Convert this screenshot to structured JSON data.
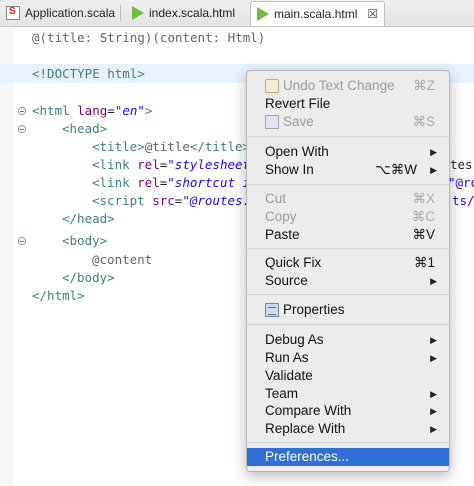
{
  "tabs": [
    {
      "label": "Application.scala",
      "icon": "scala-file-icon",
      "active": false
    },
    {
      "label": "index.scala.html",
      "icon": "play-file-icon",
      "active": false
    },
    {
      "label": "main.scala.html",
      "icon": "play-file-icon",
      "active": true,
      "close": "☒"
    }
  ],
  "code": {
    "l1": {
      "a": "@(title: String)(content: Html)"
    },
    "l2": {
      "a": "<!DOCTYPE html>"
    },
    "l3": {
      "a": "<html ",
      "b": "lang",
      "c": "=",
      "d": "\"en\"",
      "e": ">"
    },
    "l4": {
      "a": "<head>"
    },
    "l5": {
      "a": "<title>",
      "b": "@title",
      "c": "</title>"
    },
    "l6": {
      "a": "<link ",
      "b": "rel",
      "c": "=",
      "d": "\"stylesheet"
    },
    "l7": {
      "a": "<link ",
      "b": "rel",
      "c": "=",
      "d": "\"shortcut i"
    },
    "l8": {
      "a": "<script ",
      "b": "src",
      "c": "=",
      "d": "\"@routes."
    },
    "l9": {
      "a": "</head>"
    },
    "l10": {
      "a": "<body>"
    },
    "l11": {
      "a": "@content"
    },
    "l12": {
      "a": "</body>"
    },
    "l13": {
      "a": "</html>"
    },
    "overflow": {
      "o6": "tes.",
      "o7": "\"@ro",
      "o8": "ts/"
    }
  },
  "menu": {
    "undo": {
      "label": "Undo Text Change",
      "shortcut": "⌘Z"
    },
    "revert": {
      "label": "Revert File"
    },
    "save": {
      "label": "Save",
      "shortcut": "⌘S"
    },
    "open_with": {
      "label": "Open With"
    },
    "show_in": {
      "label": "Show In",
      "shortcut": "⌥⌘W"
    },
    "cut": {
      "label": "Cut",
      "shortcut": "⌘X"
    },
    "copy": {
      "label": "Copy",
      "shortcut": "⌘C"
    },
    "paste": {
      "label": "Paste",
      "shortcut": "⌘V"
    },
    "quick_fix": {
      "label": "Quick Fix",
      "shortcut": "⌘1"
    },
    "source": {
      "label": "Source"
    },
    "properties": {
      "label": "Properties"
    },
    "debug_as": {
      "label": "Debug As"
    },
    "run_as": {
      "label": "Run As"
    },
    "validate": {
      "label": "Validate"
    },
    "team": {
      "label": "Team"
    },
    "compare_with": {
      "label": "Compare With"
    },
    "replace_with": {
      "label": "Replace With"
    },
    "preferences": {
      "label": "Preferences..."
    },
    "submenu_arrow": "▶"
  },
  "colors": {
    "selection": "#2f6fd6",
    "menu_bg": "#ececec"
  }
}
